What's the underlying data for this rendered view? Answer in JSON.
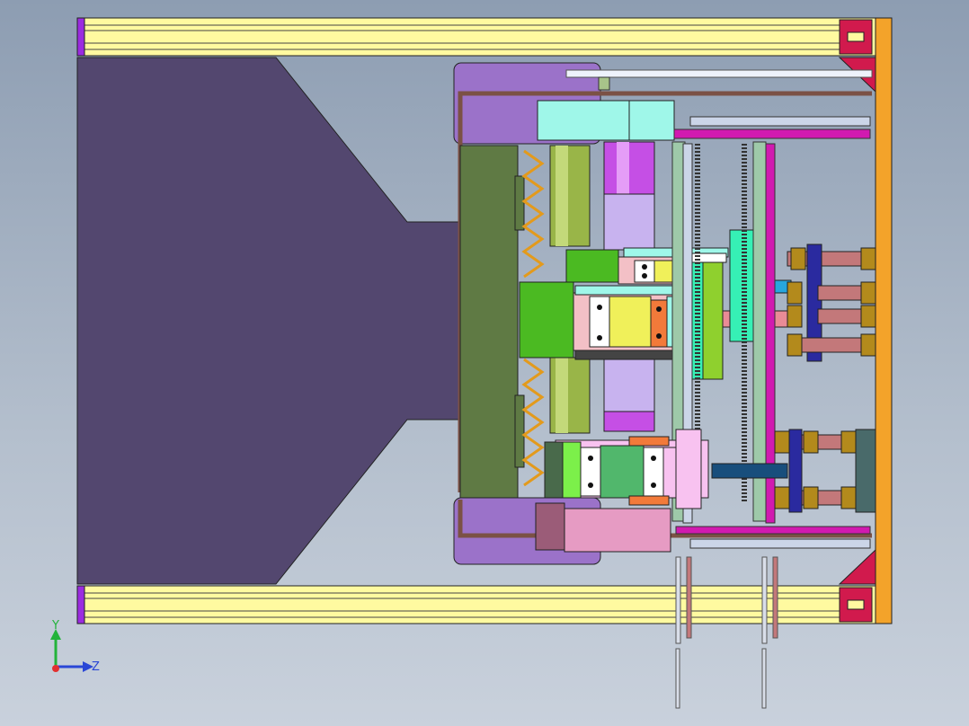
{
  "triad": {
    "y_label": "Y",
    "z_label": "Z"
  },
  "colors": {
    "background_top": "#8d9db2",
    "background_bottom": "#c9d1dc",
    "rail_yellow": "#fffaa0",
    "end_plate_orange": "#f3a32a",
    "mold_base_purple": "#53476f",
    "plate_green": "#5f7a44",
    "frame_brown": "#7b5145",
    "axis_y_green": "#23b33a",
    "axis_z_blue": "#2a47d6"
  }
}
